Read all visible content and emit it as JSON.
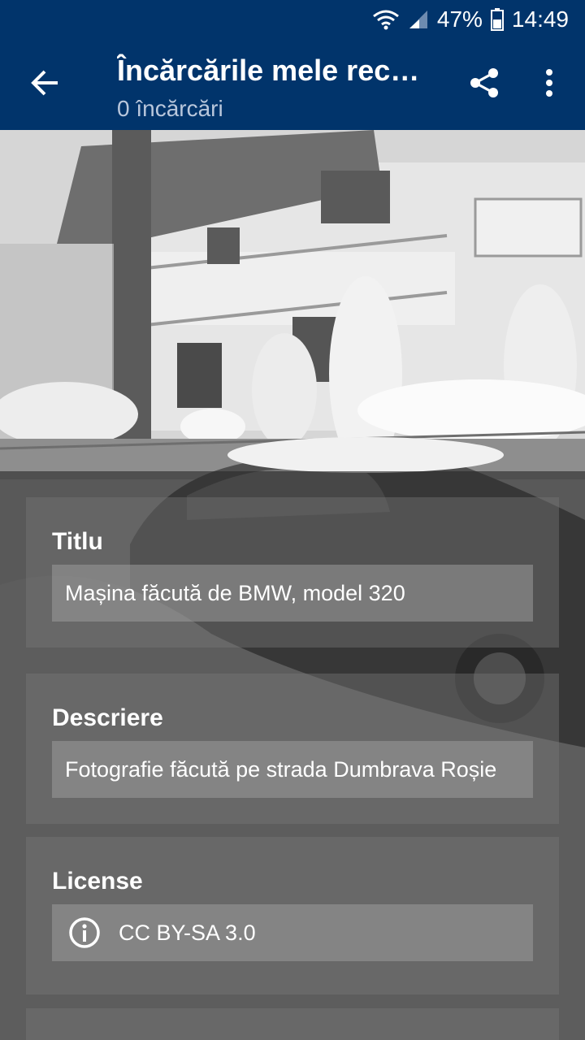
{
  "status_bar": {
    "battery": "47%",
    "time": "14:49",
    "icons": [
      "wifi-icon",
      "signal-icon",
      "battery-icon"
    ]
  },
  "toolbar": {
    "back_icon": "arrow-back-icon",
    "title": "Încărcările mele rec…",
    "subtitle": "0 încărcări",
    "share_icon": "share-icon",
    "more_icon": "more-vert-icon"
  },
  "form": {
    "title_card": {
      "label": "Titlu",
      "value": "Mașina făcută de BMW, model 320"
    },
    "description_card": {
      "label": "Descriere",
      "value": "Fotografie făcută pe strada Dumbrava Roșie"
    },
    "license_card": {
      "label": "License",
      "value": "CC BY-SA 3.0",
      "icon": "info-icon"
    }
  },
  "colors": {
    "primary": "#01346b",
    "subtitle": "#b9c7dc",
    "text": "#ffffff"
  }
}
